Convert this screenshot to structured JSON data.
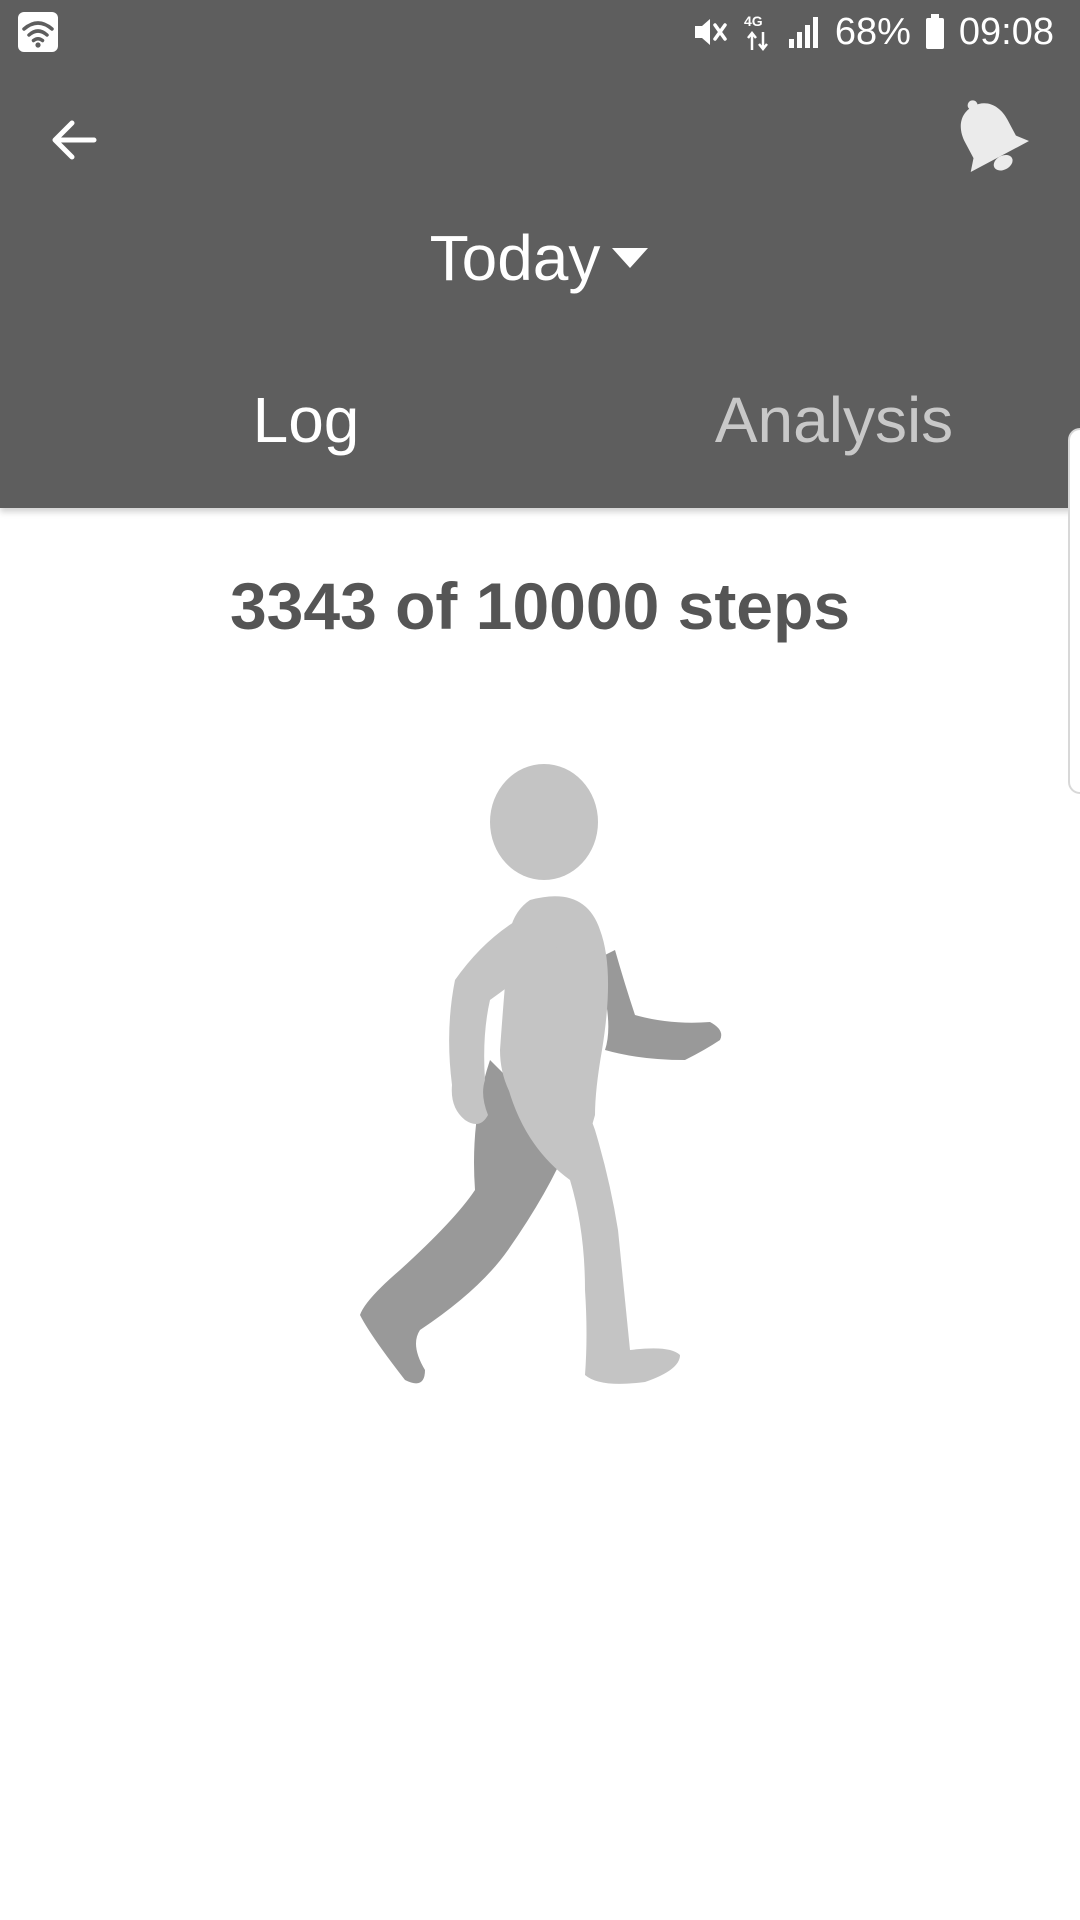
{
  "status_bar": {
    "battery_text": "68%",
    "time": "09:08",
    "icons": [
      "wifi-icon",
      "mute-icon",
      "4g-data-icon",
      "signal-icon",
      "battery-icon"
    ]
  },
  "toolbar": {
    "back_icon": "arrow-left-icon",
    "notification_icon": "bell-icon"
  },
  "period_selector": {
    "label": "Today",
    "icon": "dropdown-triangle-icon"
  },
  "tabs": [
    {
      "label": "Log",
      "active": true
    },
    {
      "label": "Analysis",
      "active": false
    }
  ],
  "steps": {
    "summary": "3343 of 10000 steps",
    "current": 3343,
    "goal": 10000
  },
  "illustration": {
    "icon": "walking-person-icon"
  },
  "colors": {
    "header_bg": "#5e5e5e",
    "active_tab": "#ffffff",
    "inactive_tab": "#c8c8c8",
    "summary_text": "#555555",
    "figure_light": "#c4c4c4",
    "figure_dark": "#999999"
  }
}
